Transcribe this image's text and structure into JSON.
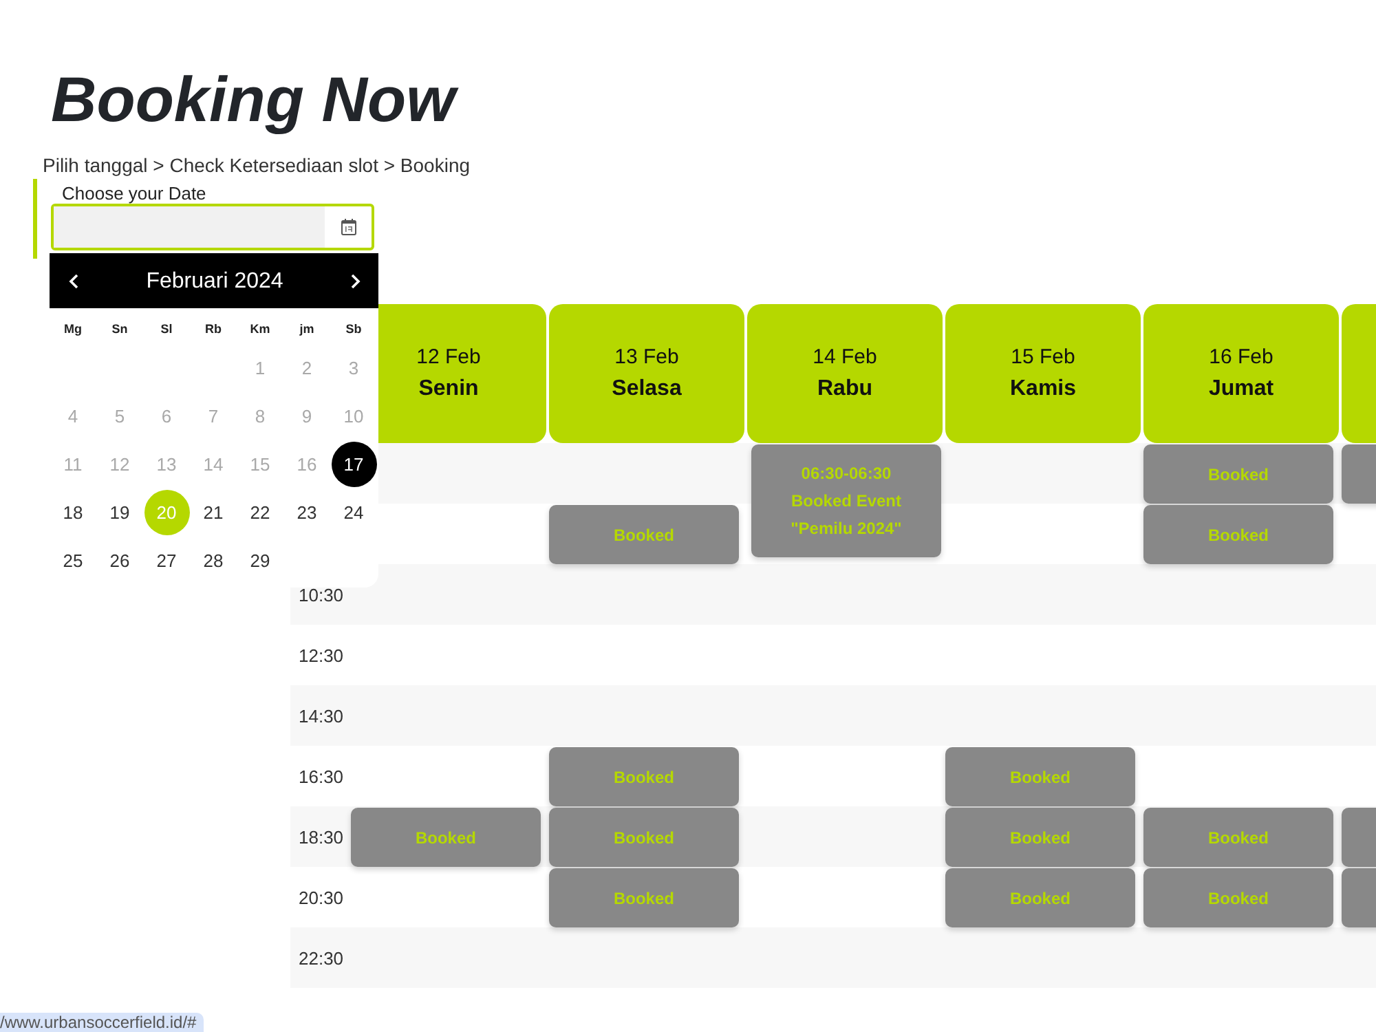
{
  "page": {
    "title": "Booking Now",
    "breadcrumb": "Pilih tanggal > Check Ketersediaan slot > Booking"
  },
  "date_picker": {
    "label": "Choose your Date",
    "calendar": {
      "month": "Februari 2024",
      "weekdays": [
        "Mg",
        "Sn",
        "Sl",
        "Rb",
        "Km",
        "jm",
        "Sb"
      ],
      "weeks": [
        [
          {
            "label": "1",
            "disabled": true,
            "selected": false,
            "today": false
          },
          {
            "label": "2",
            "disabled": true,
            "selected": false,
            "today": false
          },
          {
            "label": "3",
            "disabled": true,
            "selected": false,
            "today": false
          }
        ],
        [
          {
            "label": "4",
            "disabled": true,
            "selected": false,
            "today": false
          },
          {
            "label": "5",
            "disabled": true,
            "selected": false,
            "today": false
          },
          {
            "label": "6",
            "disabled": true,
            "selected": false,
            "today": false
          },
          {
            "label": "7",
            "disabled": true,
            "selected": false,
            "today": false
          },
          {
            "label": "8",
            "disabled": true,
            "selected": false,
            "today": false
          },
          {
            "label": "9",
            "disabled": true,
            "selected": false,
            "today": false
          },
          {
            "label": "10",
            "disabled": true,
            "selected": false,
            "today": false
          }
        ],
        [
          {
            "label": "11",
            "disabled": true,
            "selected": false,
            "today": false
          },
          {
            "label": "12",
            "disabled": true,
            "selected": false,
            "today": false
          },
          {
            "label": "13",
            "disabled": true,
            "selected": false,
            "today": false
          },
          {
            "label": "14",
            "disabled": true,
            "selected": false,
            "today": false
          },
          {
            "label": "15",
            "disabled": true,
            "selected": false,
            "today": false
          },
          {
            "label": "16",
            "disabled": true,
            "selected": false,
            "today": false
          },
          {
            "label": "17",
            "disabled": false,
            "selected": false,
            "today": true
          }
        ],
        [
          {
            "label": "18",
            "disabled": false,
            "selected": false,
            "today": false
          },
          {
            "label": "19",
            "disabled": false,
            "selected": false,
            "today": false
          },
          {
            "label": "20",
            "disabled": false,
            "selected": true,
            "today": false
          },
          {
            "label": "21",
            "disabled": false,
            "selected": false,
            "today": false
          },
          {
            "label": "22",
            "disabled": false,
            "selected": false,
            "today": false
          },
          {
            "label": "23",
            "disabled": false,
            "selected": false,
            "today": false
          },
          {
            "label": "24",
            "disabled": false,
            "selected": false,
            "today": false
          }
        ],
        [
          {
            "label": "25",
            "disabled": false,
            "selected": false,
            "today": false
          },
          {
            "label": "26",
            "disabled": false,
            "selected": false,
            "today": false
          },
          {
            "label": "27",
            "disabled": false,
            "selected": false,
            "today": false
          },
          {
            "label": "28",
            "disabled": false,
            "selected": false,
            "today": false
          },
          {
            "label": "29",
            "disabled": false,
            "selected": false,
            "today": false
          }
        ]
      ]
    }
  },
  "schedule": {
    "days": [
      {
        "date": "12 Feb",
        "weekday": "Senin"
      },
      {
        "date": "13 Feb",
        "weekday": "Selasa"
      },
      {
        "date": "14 Feb",
        "weekday": "Rabu"
      },
      {
        "date": "15 Feb",
        "weekday": "Kamis"
      },
      {
        "date": "16 Feb",
        "weekday": "Jumat"
      }
    ],
    "rows": [
      {
        "cells": [
          {
            "kind": "free"
          },
          {
            "kind": "free"
          },
          {
            "kind": "event",
            "lines": [
              "06:30-06:30",
              "Booked Event",
              "\"Pemilu 2024\""
            ]
          },
          {
            "kind": "free"
          },
          {
            "kind": "booked",
            "label": "Booked"
          },
          {
            "kind": "booked"
          }
        ]
      },
      {
        "cells": [
          {
            "kind": "free"
          },
          {
            "kind": "booked",
            "label": "Booked"
          },
          {
            "kind": "free"
          },
          {
            "kind": "free"
          },
          {
            "kind": "booked",
            "label": "Booked"
          },
          {
            "kind": "free"
          }
        ]
      },
      {
        "time": "10:30",
        "cells": [
          {
            "kind": "free"
          },
          {
            "kind": "free"
          },
          {
            "kind": "free"
          },
          {
            "kind": "free"
          },
          {
            "kind": "free"
          },
          {
            "kind": "free"
          }
        ]
      },
      {
        "time": "12:30",
        "cells": [
          {
            "kind": "free"
          },
          {
            "kind": "free"
          },
          {
            "kind": "free"
          },
          {
            "kind": "free"
          },
          {
            "kind": "free"
          },
          {
            "kind": "free"
          }
        ]
      },
      {
        "time": "14:30",
        "cells": [
          {
            "kind": "free"
          },
          {
            "kind": "free"
          },
          {
            "kind": "free"
          },
          {
            "kind": "free"
          },
          {
            "kind": "free"
          },
          {
            "kind": "free"
          }
        ]
      },
      {
        "time": "16:30",
        "cells": [
          {
            "kind": "free"
          },
          {
            "kind": "booked",
            "label": "Booked"
          },
          {
            "kind": "free"
          },
          {
            "kind": "booked",
            "label": "Booked"
          },
          {
            "kind": "free"
          },
          {
            "kind": "free"
          }
        ]
      },
      {
        "time": "18:30",
        "cells": [
          {
            "kind": "booked",
            "label": "Booked"
          },
          {
            "kind": "booked",
            "label": "Booked"
          },
          {
            "kind": "free"
          },
          {
            "kind": "booked",
            "label": "Booked"
          },
          {
            "kind": "booked",
            "label": "Booked"
          },
          {
            "kind": "booked"
          }
        ]
      },
      {
        "time": "20:30",
        "cells": [
          {
            "kind": "free"
          },
          {
            "kind": "booked",
            "label": "Booked"
          },
          {
            "kind": "free"
          },
          {
            "kind": "booked",
            "label": "Booked"
          },
          {
            "kind": "booked",
            "label": "Booked"
          },
          {
            "kind": "booked"
          }
        ]
      },
      {
        "time": "22:30",
        "cells": [
          {
            "kind": "free"
          },
          {
            "kind": "free"
          },
          {
            "kind": "free"
          },
          {
            "kind": "free"
          },
          {
            "kind": "free"
          },
          {
            "kind": "free"
          }
        ]
      }
    ]
  },
  "status_bar": {
    "url": "/www.urbansoccerfield.id/#"
  }
}
